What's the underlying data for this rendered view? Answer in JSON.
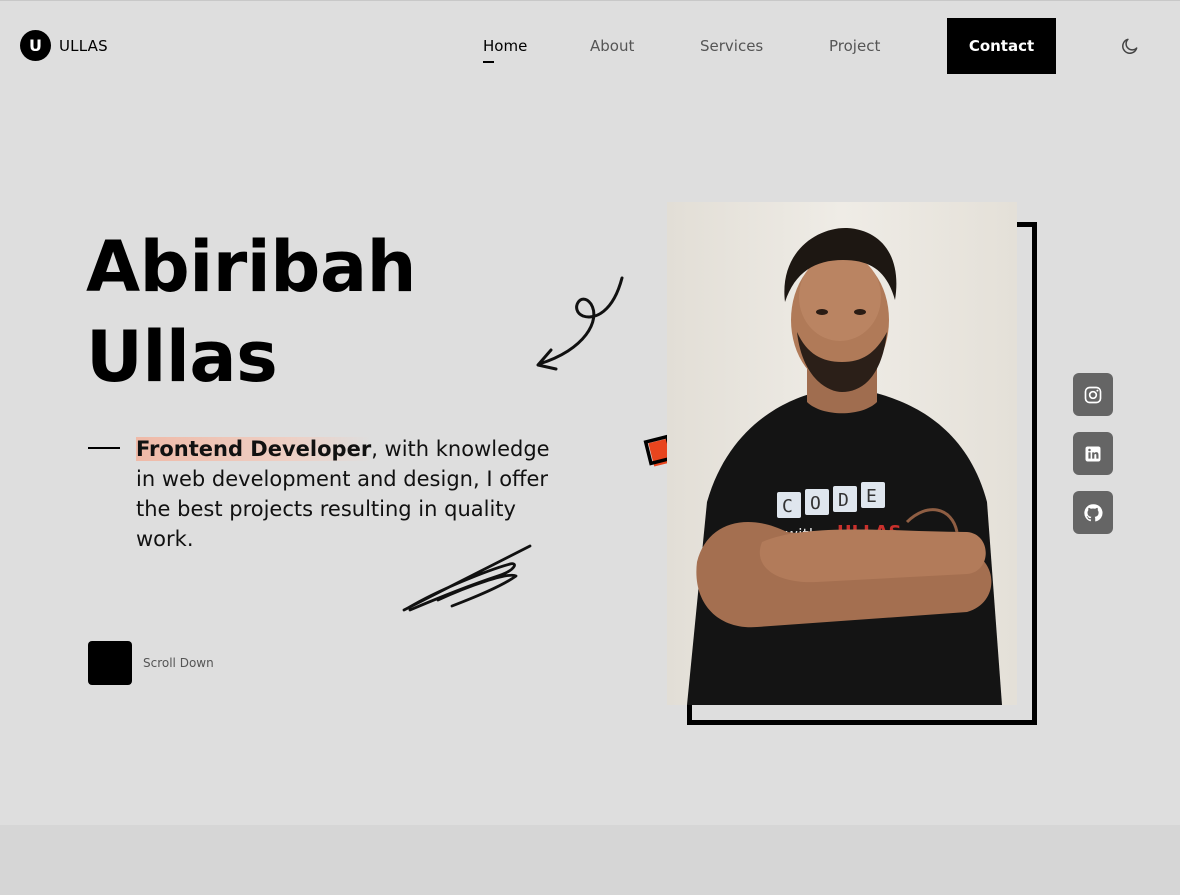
{
  "header": {
    "logo_letter": "U",
    "logo_text": "ULLAS",
    "nav": [
      {
        "label": "Home",
        "active": true
      },
      {
        "label": "About",
        "active": false
      },
      {
        "label": "Services",
        "active": false
      },
      {
        "label": "Project",
        "active": false
      }
    ],
    "contact_label": "Contact",
    "theme_icon": "moon-icon"
  },
  "hero": {
    "first_name": "Abiribah",
    "last_name": "Ullas",
    "role": "Frontend Developer",
    "description_rest": ", with knowledge in web development and design, I offer the best projects resulting in quality work.",
    "scroll_label": "Scroll Down"
  },
  "photo": {
    "shirt_word": "CODE",
    "shirt_with": "with",
    "shirt_brand": "ULLAS"
  },
  "social": [
    {
      "name": "instagram-icon"
    },
    {
      "name": "linkedin-icon"
    },
    {
      "name": "github-icon"
    }
  ],
  "colors": {
    "background": "#dedede",
    "accent": "#e8451e",
    "highlight": "#efb9a7",
    "social_bg": "#656565"
  }
}
